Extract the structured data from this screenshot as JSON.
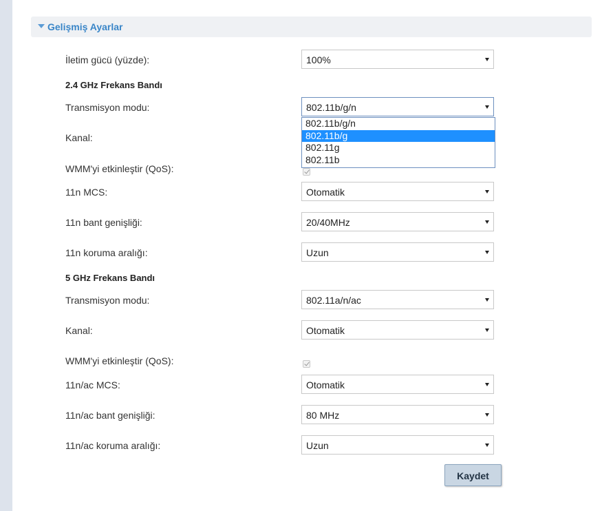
{
  "section": {
    "title": "Gelişmiş Ayarlar"
  },
  "tx_power": {
    "label": "İletim gücü (yüzde):",
    "value": "100%"
  },
  "band24": {
    "title": "2.4 GHz Frekans Bandı",
    "mode_label": "Transmisyon modu:",
    "mode_value": "802.11b/g/n",
    "mode_options": [
      "802.11b/g/n",
      "802.11b/g",
      "802.11g",
      "802.11b"
    ],
    "channel_label": "Kanal:",
    "wmm_label": "WMM'yi etkinleştir (QoS):",
    "mcs_label": "11n MCS:",
    "mcs_value": "Otomatik",
    "bw_label": "11n bant genişliği:",
    "bw_value": "20/40MHz",
    "gi_label": "11n koruma aralığı:",
    "gi_value": "Uzun"
  },
  "band5": {
    "title": "5 GHz Frekans Bandı",
    "mode_label": "Transmisyon modu:",
    "mode_value": "802.11a/n/ac",
    "channel_label": "Kanal:",
    "channel_value": "Otomatik",
    "wmm_label": "WMM'yi etkinleştir (QoS):",
    "mcs_label": "11n/ac MCS:",
    "mcs_value": "Otomatik",
    "bw_label": "11n/ac bant genişliği:",
    "bw_value": "80 MHz",
    "gi_label": "11n/ac koruma aralığı:",
    "gi_value": "Uzun"
  },
  "actions": {
    "save_label": "Kaydet"
  },
  "colors": {
    "accent": "#3a86c8",
    "highlight": "#1e90ff",
    "rail": "#dde3ec"
  }
}
